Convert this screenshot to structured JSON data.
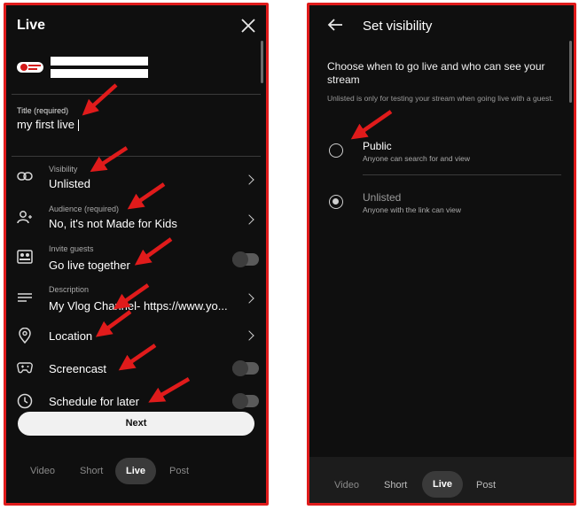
{
  "left": {
    "header": {
      "title": "Live"
    },
    "title_field": {
      "label": "Title (required)",
      "value": "my first live"
    },
    "rows": [
      {
        "label": "Visibility",
        "value": "Unlisted"
      },
      {
        "label": "Audience (required)",
        "value": "No, it's not Made for Kids"
      },
      {
        "label": "Invite guests",
        "value": "Go live together"
      },
      {
        "label": "Description",
        "value": "My Vlog Channel-  https://www.yo..."
      },
      {
        "label": "",
        "value": "Location"
      },
      {
        "label": "",
        "value": "Screencast"
      },
      {
        "label": "",
        "value": "Schedule for later"
      }
    ],
    "next_label": "Next",
    "nav": [
      "Video",
      "Short",
      "Live",
      "Post"
    ]
  },
  "right": {
    "header": {
      "title": "Set visibility"
    },
    "heading": "Choose when to go live and who can see your stream",
    "note": "Unlisted is only for testing your stream when going live with a guest.",
    "options": [
      {
        "label": "Public",
        "desc": "Anyone can search for and view",
        "selected": false
      },
      {
        "label": "Unlisted",
        "desc": "Anyone with the link can view",
        "selected": true
      }
    ],
    "nav": [
      "Video",
      "Short",
      "Live",
      "Post"
    ]
  },
  "colors": {
    "frame": "#e01b1b",
    "arrow": "#e01b1b",
    "background": "#0f0f0f"
  }
}
